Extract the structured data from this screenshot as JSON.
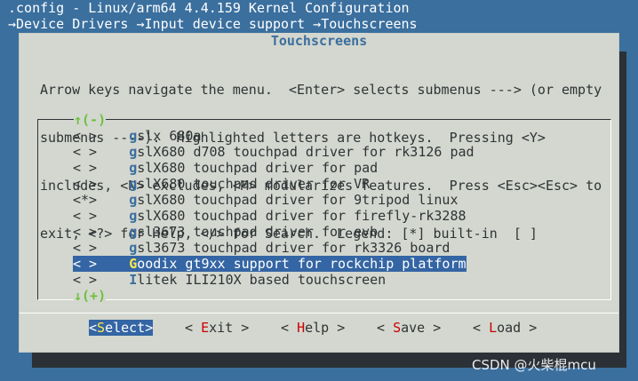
{
  "header": {
    "line1": ".config - Linux/arm64 4.4.159 Kernel Configuration",
    "line2": "→Device Drivers →Input device support →Touchscreens"
  },
  "dialog": {
    "title": "Touchscreens",
    "help": [
      "Arrow keys navigate the menu.  <Enter> selects submenus ---> (or empty",
      "submenus ----).  Highlighted letters are hotkeys.  Pressing <Y>",
      "includes, <N> excludes, <M> modularizes features.  Press <Esc><Esc> to",
      "exit, <?> for Help, </> for Search.  Legend: [*] built-in  [ ]"
    ],
    "scroll_up": "↑(-)",
    "scroll_down": "↓(+)"
  },
  "items": [
    {
      "state": "< >",
      "hotkey": "g",
      "rest": "slx 680a"
    },
    {
      "state": "< >",
      "hotkey": "g",
      "rest": "slX680 d708 touchpad driver for rk3126 pad"
    },
    {
      "state": "< >",
      "hotkey": "g",
      "rest": "slX680 touchpad driver for pad"
    },
    {
      "state": "< >",
      "hotkey": "g",
      "rest": "slX680 touchpad driver for VR"
    },
    {
      "state": "<*>",
      "hotkey": "g",
      "rest": "slX680 touchpad driver for 9tripod linux"
    },
    {
      "state": "< >",
      "hotkey": "g",
      "rest": "slX680 touchpad driver for firefly-rk3288"
    },
    {
      "state": "< >",
      "hotkey": "g",
      "rest": "sl3673 touchpad driver for evb"
    },
    {
      "state": "< >",
      "hotkey": "g",
      "rest": "sl3673 touchpad driver for rk3326 board"
    },
    {
      "state": "< >",
      "hotkey": "G",
      "rest": "oodix gt9xx support for rockchip platform"
    },
    {
      "state": "< >",
      "hotkey": "I",
      "rest": "litek ILI210X based touchscreen"
    }
  ],
  "selected_index": 8,
  "buttons": [
    {
      "pre": "<",
      "hotkey": "S",
      "post": "elect>"
    },
    {
      "pre": "< ",
      "hotkey": "E",
      "post": "xit >"
    },
    {
      "pre": "< ",
      "hotkey": "H",
      "post": "elp >"
    },
    {
      "pre": "< ",
      "hotkey": "S",
      "post": "ave >"
    },
    {
      "pre": "< ",
      "hotkey": "L",
      "post": "oad >"
    }
  ],
  "watermark": "CSDN @火柴棍mcu"
}
